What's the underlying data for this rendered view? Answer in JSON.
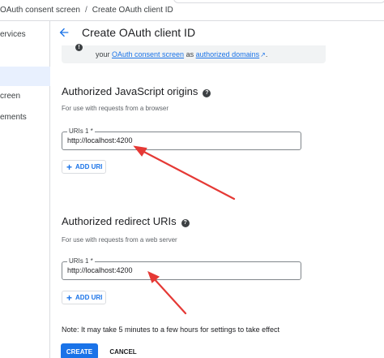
{
  "breadcrumb": {
    "items": [
      "OAuth consent screen",
      "Create OAuth client ID"
    ],
    "separator": "/"
  },
  "sidenav": {
    "items": [
      {
        "label": "ervices",
        "active": false
      },
      {
        "label": "",
        "active": true
      },
      {
        "label": "creen",
        "active": false
      },
      {
        "label": "ements",
        "active": false
      }
    ]
  },
  "header": {
    "title": "Create OAuth client ID",
    "back_icon": "arrow-back-icon"
  },
  "banner": {
    "icon": "info-icon",
    "prefix": "your ",
    "link1": "OAuth consent screen",
    "middle": " as ",
    "link2": "authorized domains",
    "ext_icon": "↗",
    "suffix": "."
  },
  "js_origins": {
    "title": "Authorized JavaScript origins",
    "help_icon": "help-icon",
    "description": "For use with requests from a browser",
    "field_label": "URIs 1 *",
    "field_value": "http://localhost:4200",
    "add_label": "ADD URI"
  },
  "redirect_uris": {
    "title": "Authorized redirect URIs",
    "help_icon": "help-icon",
    "description": "For use with requests from a web server",
    "field_label": "URIs 1 *",
    "field_value": "http://localhost:4200",
    "add_label": "ADD URI"
  },
  "note": "Note: It may take 5 minutes to a few hours for settings to take effect",
  "actions": {
    "create": "CREATE",
    "cancel": "CANCEL"
  },
  "colors": {
    "accent": "#1a73e8",
    "annotation_arrow": "#e53935",
    "banner_bg": "#f1f3f4"
  }
}
